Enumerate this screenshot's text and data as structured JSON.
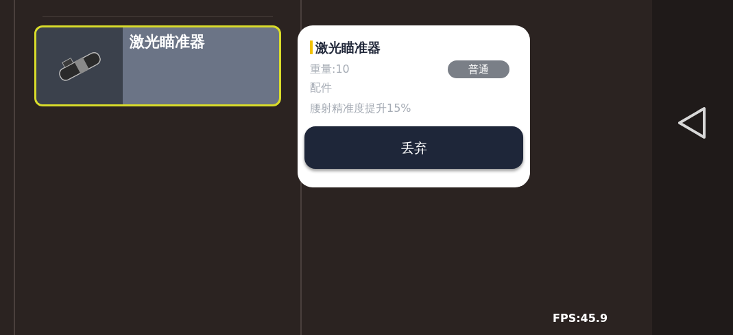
{
  "inventory": {
    "items": [
      {
        "name": "激光瞄准器",
        "selected": true
      }
    ]
  },
  "tooltip": {
    "title": "激光瞄准器",
    "weight": "重量:10",
    "rarity": "普通",
    "category": "配件",
    "effect": "腰射精准度提升15%",
    "button": "丢弃"
  },
  "fps": "FPS:45.9"
}
